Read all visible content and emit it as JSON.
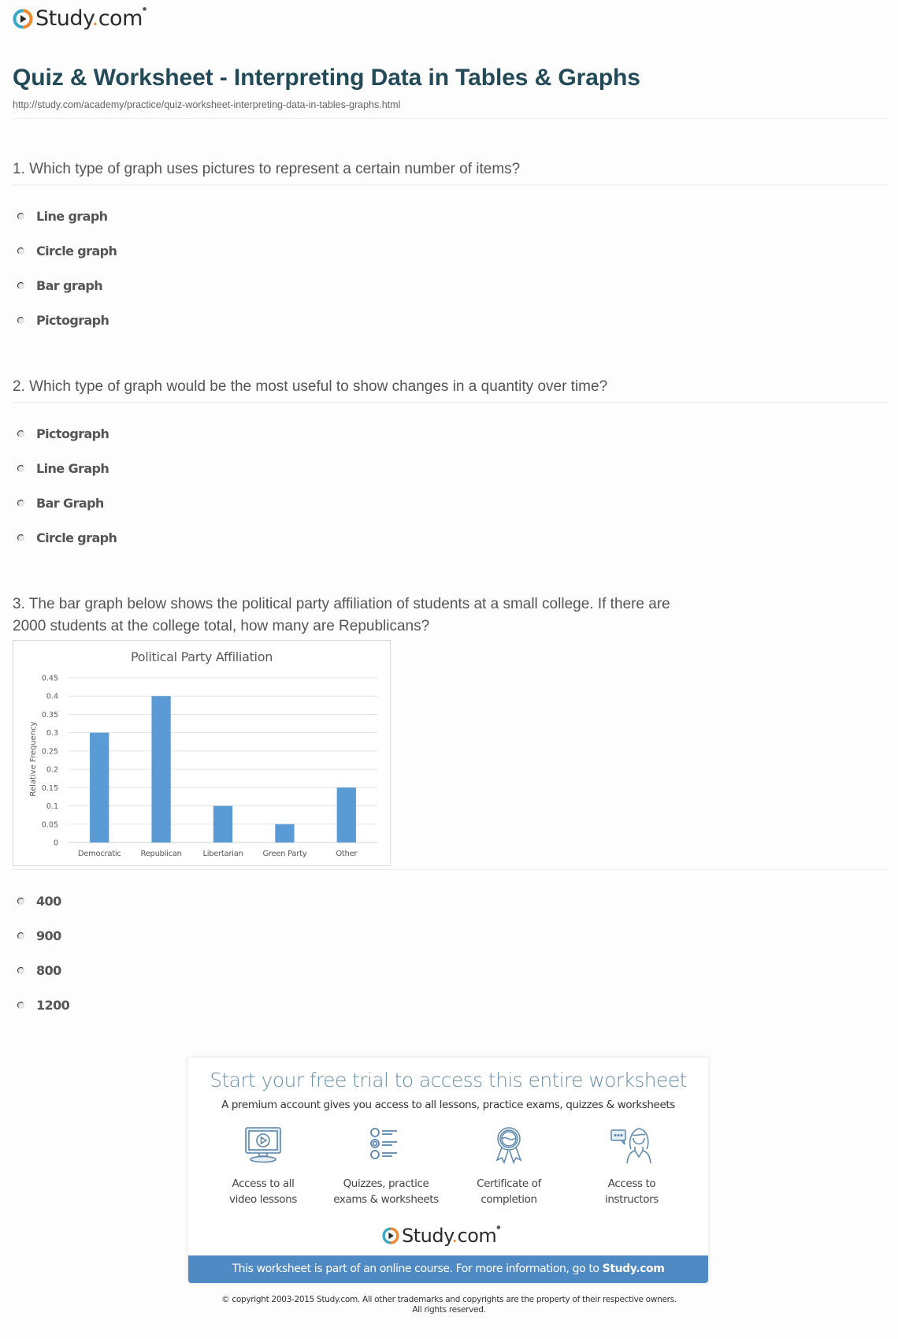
{
  "brand": {
    "name_main": "Study",
    "name_dot": ".",
    "name_tld": "com",
    "colors": {
      "ring_blue": "#3aa6c8",
      "ring_orange": "#f08a2c",
      "dot": "#f08a2c",
      "text": "#2a2a2a"
    }
  },
  "header": {
    "title": "Quiz & Worksheet - Interpreting Data in Tables & Graphs",
    "url": "http://study.com/academy/practice/quiz-worksheet-interpreting-data-in-tables-graphs.html"
  },
  "questions": [
    {
      "text": "1. Which type of graph uses pictures to represent a certain number of items?",
      "options": [
        "Line graph",
        "Circle graph",
        "Bar graph",
        "Pictograph"
      ]
    },
    {
      "text": "2. Which type of graph would be the most useful to show changes in a quantity over time?",
      "options": [
        "Pictograph",
        "Line Graph",
        "Bar Graph",
        "Circle graph"
      ]
    },
    {
      "text_line1": "3. The bar graph below shows the political party affiliation of students at a small college. If there are",
      "text_line2": "2000 students at the college total, how many are Republicans?",
      "options": [
        "400",
        "900",
        "800",
        "1200"
      ]
    }
  ],
  "chart_data": {
    "type": "bar",
    "title": "Political Party Affiliation",
    "xlabel": "",
    "ylabel": "Relative Frequency",
    "categories": [
      "Democratic",
      "Republican",
      "Libertarian",
      "Green Party",
      "Other"
    ],
    "values": [
      0.3,
      0.4,
      0.1,
      0.05,
      0.15
    ],
    "ylim": [
      0,
      0.45
    ],
    "yticks": [
      "0",
      "0.05",
      "0.1",
      "0.15",
      "0.2",
      "0.25",
      "0.3",
      "0.35",
      "0.4",
      "0.45"
    ],
    "grid": true,
    "bar_color": "#5b9bd5"
  },
  "promo": {
    "title": "Start your free trial to access this entire worksheet",
    "subtitle": "A premium account gives you access to all lessons, practice exams, quizzes & worksheets",
    "features": [
      {
        "icon": "video-monitor-icon",
        "line1": "Access to all",
        "line2": "video lessons"
      },
      {
        "icon": "quiz-list-icon",
        "line1": "Quizzes, practice",
        "line2": "exams & worksheets"
      },
      {
        "icon": "certificate-ribbon-icon",
        "line1": "Certificate of",
        "line2": "completion"
      },
      {
        "icon": "instructor-chat-icon",
        "line1": "Access to",
        "line2": "instructors"
      }
    ],
    "banner_text": "This worksheet is part of an online course. For more information, go to ",
    "banner_link": "Study.com",
    "banner_color": "#4f8ac4"
  },
  "footer": {
    "copyright_line1": "© copyright 2003-2015 Study.com. All other trademarks and copyrights are the property of their respective owners.",
    "copyright_line2": "All rights reserved."
  }
}
